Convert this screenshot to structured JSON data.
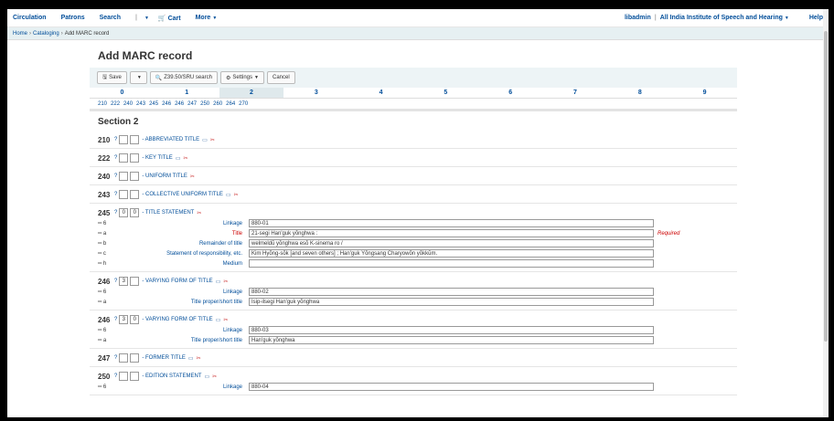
{
  "navbar": {
    "left": [
      "Circulation",
      "Patrons",
      "Search"
    ],
    "cart": "Cart",
    "more": "More",
    "user": "libadmin",
    "library": "All India Institute of Speech and Hearing",
    "help": "Help"
  },
  "breadcrumb": {
    "home": "Home",
    "cataloging": "Cataloging",
    "current": "Add MARC record"
  },
  "page_title": "Add MARC record",
  "toolbar": {
    "save": "Save",
    "z3950": "Z39.50/SRU search",
    "settings": "Settings",
    "cancel": "Cancel"
  },
  "tabs": [
    "0",
    "1",
    "2",
    "3",
    "4",
    "5",
    "6",
    "7",
    "8",
    "9"
  ],
  "active_tab": "2",
  "tag_links": [
    "210",
    "222",
    "240",
    "243",
    "245",
    "246",
    "246",
    "247",
    "250",
    "260",
    "264",
    "270"
  ],
  "section_title": "Section 2",
  "fields": [
    {
      "tag": "210",
      "q": "?",
      "ind1": "",
      "ind2": "",
      "label": "- ABBREVIATED TITLE",
      "subfields": []
    },
    {
      "tag": "222",
      "q": "?",
      "ind1": "",
      "ind2": "",
      "label": "- KEY TITLE",
      "subfields": []
    },
    {
      "tag": "240",
      "q": "?",
      "ind1": "",
      "ind2": "",
      "label": "- UNIFORM TITLE",
      "subfields": []
    },
    {
      "tag": "243",
      "q": "?",
      "ind1": "",
      "ind2": "",
      "label": "- COLLECTIVE UNIFORM TITLE",
      "subfields": []
    },
    {
      "tag": "245",
      "q": "?",
      "ind1": "0",
      "ind2": "0",
      "label": "- TITLE STATEMENT",
      "subfields": [
        {
          "code": "6",
          "label": "Linkage",
          "value": "880-01"
        },
        {
          "code": "a",
          "label": "Title",
          "value": "21-segi Han'guk yŏnghwa :",
          "required": "Required"
        },
        {
          "code": "b",
          "label": "Remainder of title",
          "value": "welmeldŭ yŏnghwa esŏ K-sinema ro /"
        },
        {
          "code": "c",
          "label": "Statement of responsibility, etc.",
          "value": "Kim Hyŏng-sŏk [and seven others] ; Han'guk Yŏngsang Charyowŏn yŏkkŭm."
        },
        {
          "code": "h",
          "label": "Medium",
          "value": ""
        }
      ]
    },
    {
      "tag": "246",
      "q": "?",
      "ind1": "3",
      "ind2": "",
      "label": "- VARYING FORM OF TITLE",
      "subfields": [
        {
          "code": "6",
          "label": "Linkage",
          "value": "880-02"
        },
        {
          "code": "a",
          "label": "Title proper/short title",
          "value": "Isip-ilsegi Han'guk yŏnghwa"
        }
      ]
    },
    {
      "tag": "246",
      "q": "?",
      "ind1": "3",
      "ind2": "0",
      "label": "- VARYING FORM OF TITLE",
      "subfields": [
        {
          "code": "6",
          "label": "Linkage",
          "value": "880-03"
        },
        {
          "code": "a",
          "label": "Title proper/short title",
          "value": "Han'guk yŏnghwa"
        }
      ]
    },
    {
      "tag": "247",
      "q": "?",
      "ind1": "",
      "ind2": "",
      "label": "- FORMER TITLE",
      "subfields": []
    },
    {
      "tag": "250",
      "q": "?",
      "ind1": "",
      "ind2": "",
      "label": "- EDITION STATEMENT",
      "subfields": [
        {
          "code": "6",
          "label": "Linkage",
          "value": "880-04"
        }
      ]
    }
  ],
  "colors": {
    "link": "#004d99",
    "required": "#cc0000",
    "toolbar_bg": "#edf4f6"
  }
}
